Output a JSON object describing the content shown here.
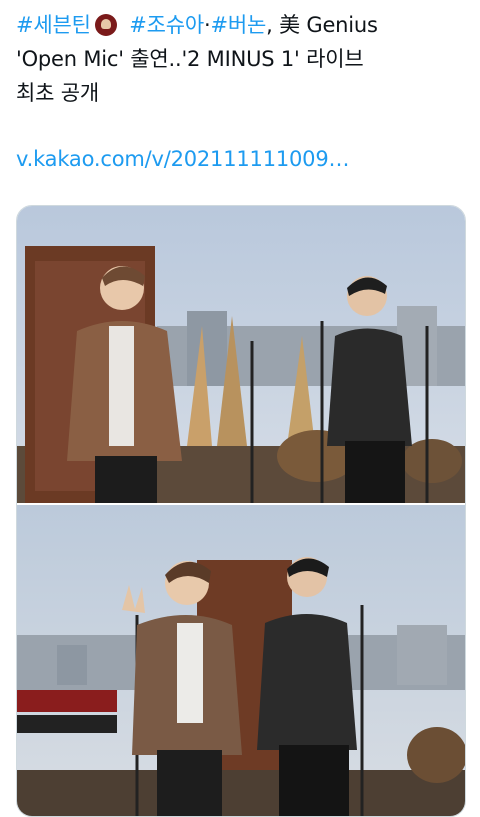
{
  "tweet": {
    "hashtag_1": "#세븐틴",
    "hashtag_2": "#조슈아",
    "separator": "·",
    "hashtag_3": "#버논",
    "text_1": ", 美 Genius",
    "text_2": "'Open Mic' 출연..'2 MINUS 1' 라이브",
    "text_3": "최초 공개",
    "link": "v.kakao.com/v/202111111009…"
  },
  "media": {
    "count": 2,
    "photos": [
      {
        "description_icon": "photo-icon"
      },
      {
        "description_icon": "photo-icon"
      }
    ]
  }
}
